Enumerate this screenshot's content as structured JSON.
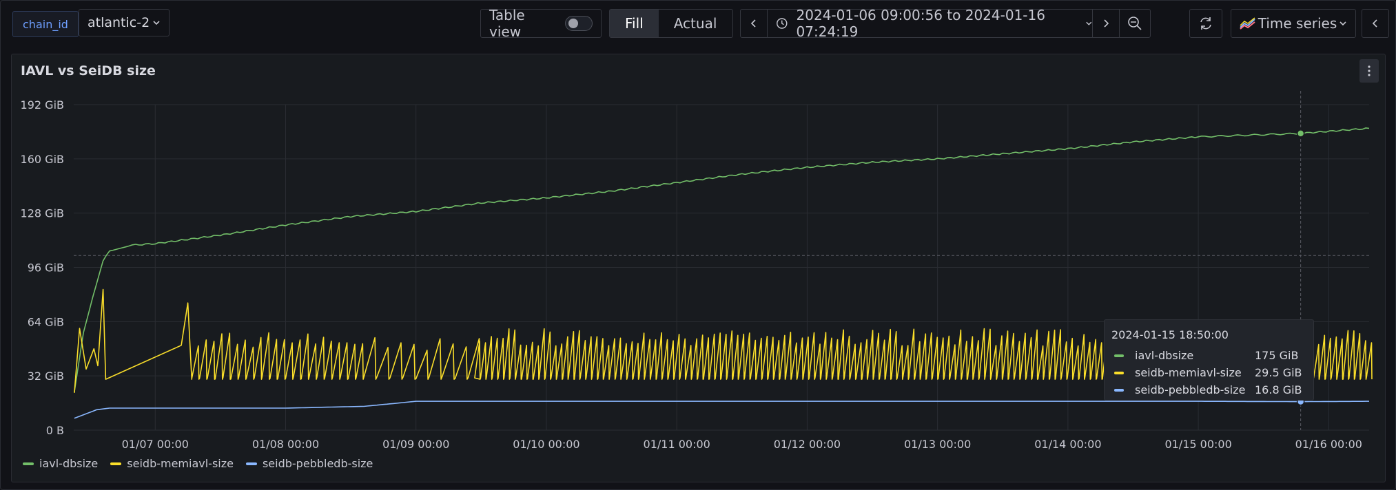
{
  "toolbar": {
    "variable_name": "chain_id",
    "variable_value": "atlantic-2",
    "table_view_label": "Table view",
    "fill_label": "Fill",
    "actual_label": "Actual",
    "time_range": "2024-01-06 09:00:56 to 2024-01-16 07:24:19",
    "viz_label": "Time series"
  },
  "panel": {
    "title": "IAVL vs SeiDB size"
  },
  "colors": {
    "iavl": "#73bf69",
    "memiavl": "#fade2a",
    "pebble": "#8ab8ff",
    "grid": "#2a2d33",
    "axis_text": "#c7c8d1"
  },
  "chart_data": {
    "type": "line",
    "ylabel": "",
    "y_unit": "GiB",
    "ylim": [
      0,
      192
    ],
    "y_ticks": [
      {
        "value": 0,
        "label": "0 B"
      },
      {
        "value": 32,
        "label": "32 GiB"
      },
      {
        "value": 64,
        "label": "64 GiB"
      },
      {
        "value": 96,
        "label": "96 GiB"
      },
      {
        "value": 128,
        "label": "128 GiB"
      },
      {
        "value": 160,
        "label": "160 GiB"
      },
      {
        "value": 192,
        "label": "192 GiB"
      }
    ],
    "x_unit": "days since 2024-01-06 00:00",
    "xlim": [
      0.375,
      10.31
    ],
    "x_ticks": [
      {
        "value": 1,
        "label": "01/07 00:00"
      },
      {
        "value": 2,
        "label": "01/08 00:00"
      },
      {
        "value": 3,
        "label": "01/09 00:00"
      },
      {
        "value": 4,
        "label": "01/10 00:00"
      },
      {
        "value": 5,
        "label": "01/11 00:00"
      },
      {
        "value": 6,
        "label": "01/12 00:00"
      },
      {
        "value": 7,
        "label": "01/13 00:00"
      },
      {
        "value": 8,
        "label": "01/14 00:00"
      },
      {
        "value": 9,
        "label": "01/15 00:00"
      },
      {
        "value": 10,
        "label": "01/16 00:00"
      }
    ],
    "series": [
      {
        "name": "iavl-dbsize",
        "color": "#73bf69",
        "points": [
          [
            0.38,
            22
          ],
          [
            0.45,
            58
          ],
          [
            0.52,
            78
          ],
          [
            0.6,
            100
          ],
          [
            0.65,
            106
          ],
          [
            0.8,
            109
          ],
          [
            1.0,
            110
          ],
          [
            1.5,
            115
          ],
          [
            2.0,
            121
          ],
          [
            2.5,
            126
          ],
          [
            3.0,
            129
          ],
          [
            3.5,
            134
          ],
          [
            4.0,
            137
          ],
          [
            4.5,
            141
          ],
          [
            5.0,
            146
          ],
          [
            5.5,
            151
          ],
          [
            6.0,
            155
          ],
          [
            6.5,
            158
          ],
          [
            7.0,
            160
          ],
          [
            7.5,
            163
          ],
          [
            8.0,
            166
          ],
          [
            8.5,
            170
          ],
          [
            9.0,
            173
          ],
          [
            9.78,
            175
          ],
          [
            10.31,
            178
          ]
        ]
      },
      {
        "name": "seidb-memiavl-size",
        "color": "#fade2a",
        "style": "sawtooth",
        "points": [
          [
            0.38,
            22
          ],
          [
            0.42,
            60
          ],
          [
            0.47,
            36
          ],
          [
            0.53,
            48
          ],
          [
            0.56,
            38
          ],
          [
            0.6,
            83
          ],
          [
            0.62,
            30
          ],
          [
            1.2,
            50
          ],
          [
            1.25,
            75
          ],
          [
            1.28,
            30
          ],
          [
            1.85,
            28
          ],
          [
            2.1,
            27
          ],
          [
            3.0,
            28
          ],
          [
            3.3,
            32
          ],
          [
            3.45,
            58
          ],
          [
            10.31,
            34
          ]
        ],
        "saw_segments": [
          {
            "from": 1.28,
            "to": 2.6,
            "period": 0.06,
            "low": 30,
            "high": 58
          },
          {
            "from": 2.6,
            "to": 3.45,
            "period": 0.1,
            "low": 30,
            "high": 56
          },
          {
            "from": 3.45,
            "to": 10.31,
            "period": 0.045,
            "low": 30,
            "high": 60
          }
        ]
      },
      {
        "name": "seidb-pebbledb-size",
        "color": "#8ab8ff",
        "points": [
          [
            0.38,
            7
          ],
          [
            0.55,
            12
          ],
          [
            0.65,
            13
          ],
          [
            1.0,
            13
          ],
          [
            2.0,
            13
          ],
          [
            2.6,
            14
          ],
          [
            3.0,
            17
          ],
          [
            4.0,
            17
          ],
          [
            5.0,
            17
          ],
          [
            6.0,
            17
          ],
          [
            7.0,
            17
          ],
          [
            8.0,
            17
          ],
          [
            9.0,
            17
          ],
          [
            9.78,
            16.8
          ],
          [
            10.31,
            17
          ]
        ]
      }
    ],
    "crosshair": {
      "x": 9.785,
      "y_guide": 103
    }
  },
  "tooltip": {
    "time": "2024-01-15 18:50:00",
    "rows": [
      {
        "name": "iavl-dbsize",
        "value": "175 GiB",
        "color": "#73bf69",
        "y": 175
      },
      {
        "name": "seidb-memiavl-size",
        "value": "29.5 GiB",
        "color": "#fade2a",
        "y": 29.5
      },
      {
        "name": "seidb-pebbledb-size",
        "value": "16.8 GiB",
        "color": "#8ab8ff",
        "y": 16.8
      }
    ]
  }
}
